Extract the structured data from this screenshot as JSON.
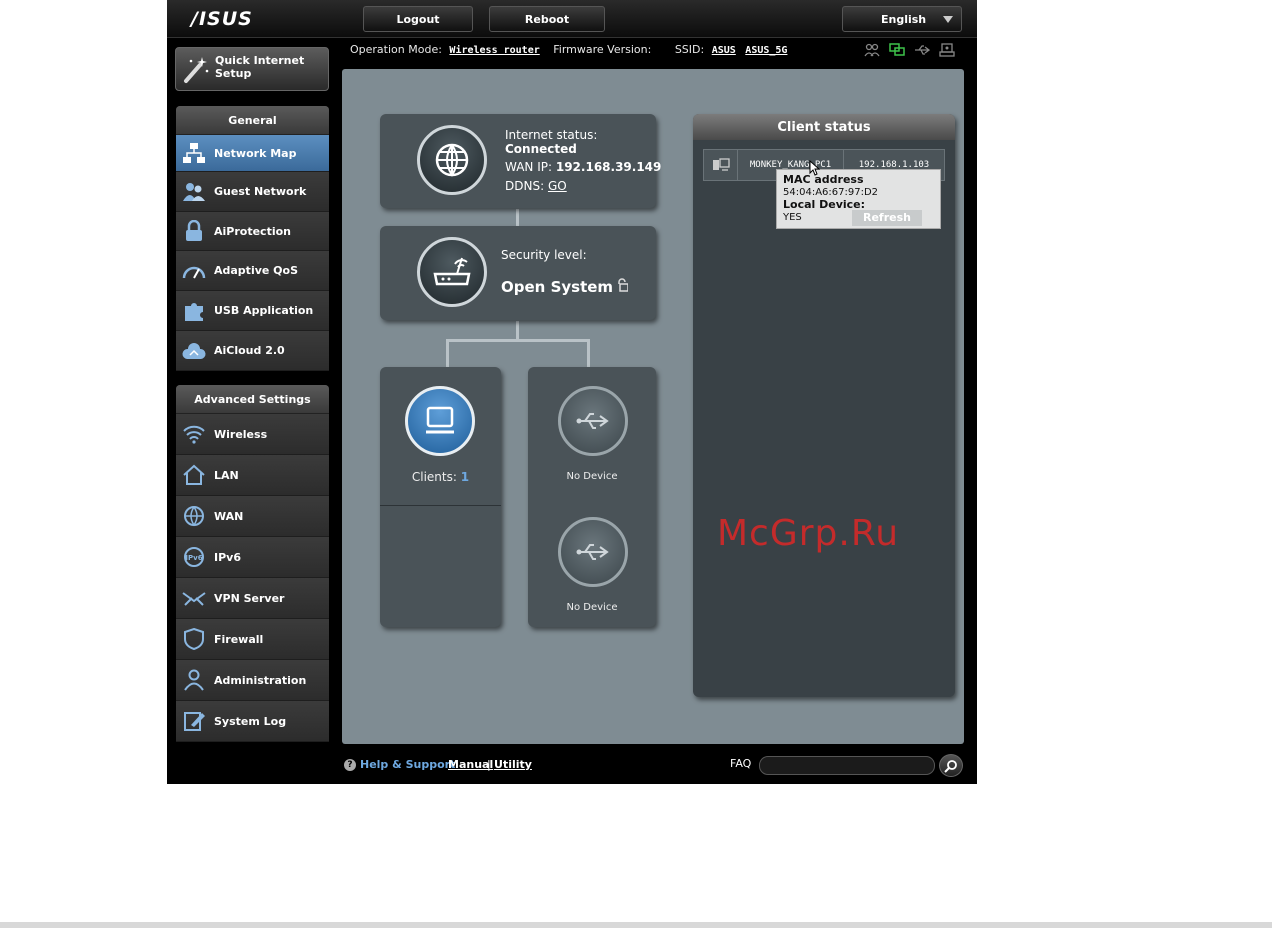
{
  "header": {
    "logo": "/ISUS",
    "logout_label": "Logout",
    "reboot_label": "Reboot",
    "language": "English"
  },
  "status_line": {
    "op_mode_label": "Operation Mode:",
    "op_mode_value": "Wireless router",
    "firmware_label": "Firmware Version:",
    "ssid_label": "SSID:",
    "ssid_1": "ASUS",
    "ssid_2": "ASUS_5G"
  },
  "sidebar": {
    "quick_setup": "Quick Internet Setup",
    "general_header": "General",
    "general_items": [
      {
        "label": "Network Map",
        "icon": "network-map-icon",
        "active": true
      },
      {
        "label": "Guest Network",
        "icon": "guest-network-icon"
      },
      {
        "label": "AiProtection",
        "icon": "lock-icon"
      },
      {
        "label": "Adaptive QoS",
        "icon": "gauge-icon"
      },
      {
        "label": "USB Application",
        "icon": "puzzle-icon"
      },
      {
        "label": "AiCloud 2.0",
        "icon": "cloud-icon"
      }
    ],
    "advanced_header": "Advanced Settings",
    "advanced_items": [
      {
        "label": "Wireless",
        "icon": "wifi-icon"
      },
      {
        "label": "LAN",
        "icon": "home-icon"
      },
      {
        "label": "WAN",
        "icon": "globe-icon"
      },
      {
        "label": "IPv6",
        "icon": "ipv6-icon"
      },
      {
        "label": "VPN Server",
        "icon": "vpn-icon"
      },
      {
        "label": "Firewall",
        "icon": "shield-icon"
      },
      {
        "label": "Administration",
        "icon": "user-icon"
      },
      {
        "label": "System Log",
        "icon": "log-icon"
      }
    ]
  },
  "network_map": {
    "internet_status_label": "Internet status:",
    "internet_status_value": "Connected",
    "wan_ip_label": "WAN IP:",
    "wan_ip_value": "192.168.39.149",
    "ddns_label": "DDNS:",
    "ddns_link": "GO",
    "security_label": "Security level:",
    "security_value": "Open System",
    "clients_label": "Clients:",
    "clients_count": "1",
    "usb1_label": "No Device",
    "usb2_label": "No Device"
  },
  "client_status": {
    "title": "Client status",
    "rows": [
      {
        "name": "MONKEY_KANG-PC1",
        "ip": "192.168.1.103"
      }
    ],
    "tooltip": {
      "mac_label": "MAC address",
      "mac_value": "54:04:A6:67:97:D2",
      "local_label": "Local Device:",
      "local_value": "YES"
    },
    "refresh_label": "Refresh"
  },
  "watermark": "McGrp.Ru",
  "footer": {
    "help_label": "Help & Support",
    "manual_label": "Manual",
    "separator": "|",
    "utility_label": "Utility",
    "faq_label": "FAQ",
    "faq_placeholder": ""
  },
  "colors": {
    "active_item": "#4a7db0",
    "main_bg": "#7f8c93",
    "panel_bg": "#4a5358",
    "watermark": "#d72828",
    "link_blue": "#6ea8e0"
  }
}
